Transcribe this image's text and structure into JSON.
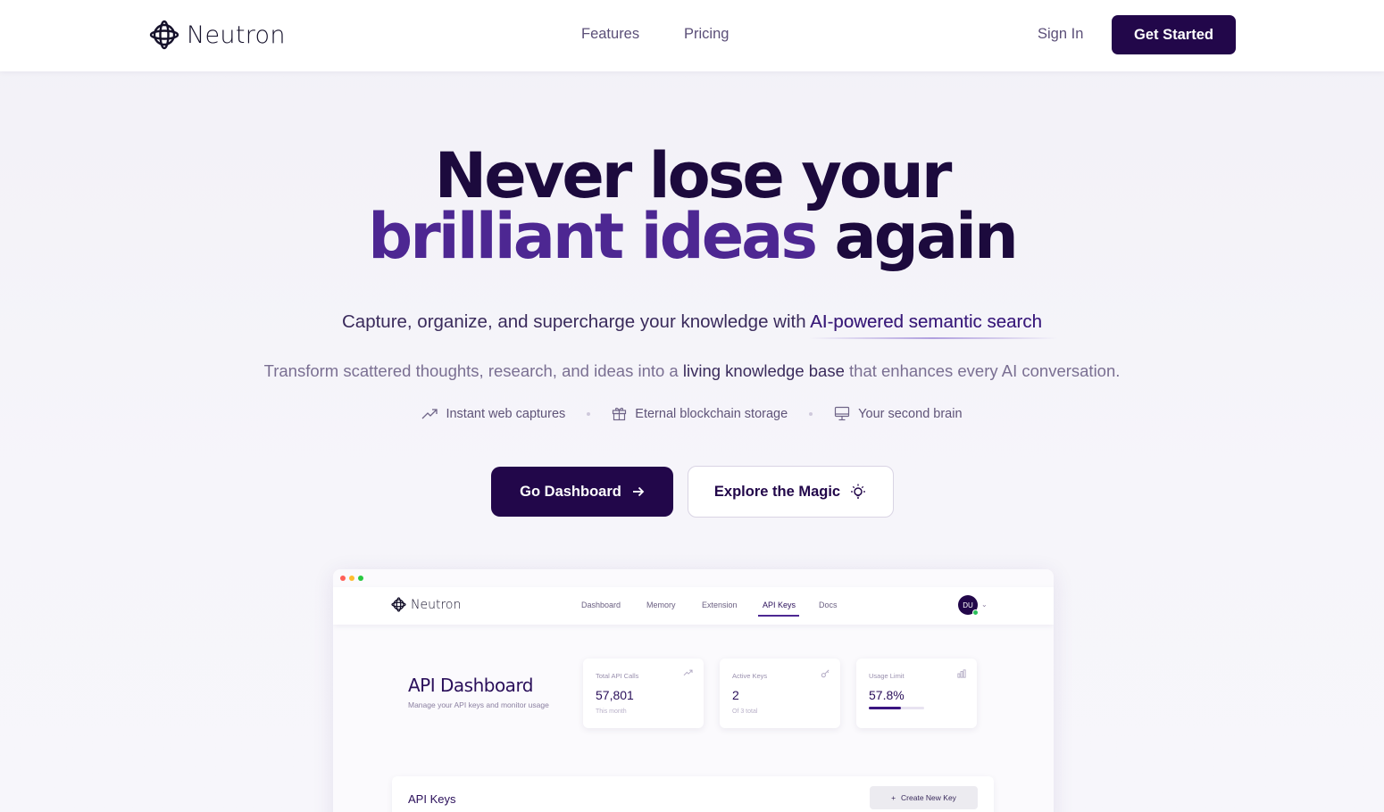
{
  "nav": {
    "logo_text": "Neutron",
    "links": {
      "features": "Features",
      "pricing": "Pricing"
    },
    "sign_in": "Sign In",
    "get_started": "Get Started"
  },
  "hero": {
    "title_line1": "Never lose your",
    "title_accent": "brilliant ideas",
    "title_tail": "again",
    "subtitle_prefix": "Capture, organize, and supercharge your knowledge with",
    "subtitle_highlight": "AI-powered semantic search",
    "desc_prefix": "Transform scattered thoughts, research, and ideas into a",
    "desc_strong": "living knowledge base",
    "desc_suffix": "that enhances every AI conversation.",
    "features": [
      {
        "icon": "trending-up-icon",
        "label": "Instant web captures"
      },
      {
        "icon": "gift-icon",
        "label": "Eternal blockchain storage"
      },
      {
        "icon": "monitor-icon",
        "label": "Your second brain"
      }
    ],
    "primary_button": "Go Dashboard",
    "secondary_button": "Explore the Magic"
  },
  "preview": {
    "logo_text": "Neutron",
    "nav_links": [
      "Dashboard",
      "Memory",
      "Extension",
      "API Keys",
      "Docs"
    ],
    "active_link": "API Keys",
    "avatar_initials": "DU",
    "title": "API Dashboard",
    "subtitle": "Manage your API keys and monitor usage",
    "stats": [
      {
        "label": "Total API Calls",
        "value": "57,801",
        "note": "This month",
        "icon": "trending-up-icon"
      },
      {
        "label": "Active Keys",
        "value": "2",
        "note": "Of 3 total",
        "icon": "key-icon"
      },
      {
        "label": "Usage Limit",
        "value": "57.8%",
        "icon": "bar-chart-icon",
        "progress": 0.578
      }
    ],
    "keys_title": "API Keys",
    "create_key_button": "Create New Key"
  },
  "colors": {
    "brand_dark": "#22074a",
    "accent_purple": "#4d2792",
    "window_dot_red": "#ff5f57",
    "window_dot_yellow": "#febc2e",
    "window_dot_green": "#28c840"
  }
}
